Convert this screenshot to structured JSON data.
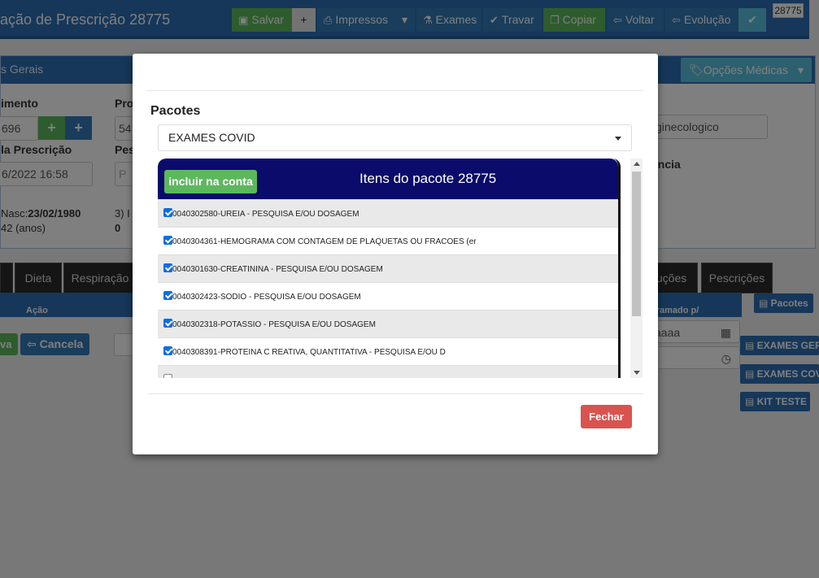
{
  "header": {
    "title": "ação de Prescrição 28775",
    "badge": "28775",
    "buttons": {
      "salvar": "Salvar",
      "plus": "+",
      "impressos": "Impressos",
      "exames": "Exames",
      "travar": "Travar",
      "copiar": "Copiar",
      "voltar": "Voltar",
      "evolucao": "Evolução",
      "check": "✔"
    }
  },
  "panel": {
    "title": "s Gerais",
    "opcoes_medicas": "Opções Médicas",
    "labels": {
      "atendimento": "imento",
      "prof": "Pro",
      "data_prescricao": "la Prescrição",
      "pes": "Pes",
      "urgencia": "ência"
    },
    "values": {
      "atendimento": "696",
      "prof": "54",
      "data_prescricao": "6/2022 16:58",
      "pes": "P",
      "tipo": "ginecologico",
      "nasc_label": "Nasc:",
      "nasc_value": "23/02/1980",
      "idade": "42 (anos)",
      "item3": "3) I",
      "item3_value": "0"
    }
  },
  "tabs": [
    "",
    "Dieta",
    "Respiração",
    "luções",
    "Pescrições"
  ],
  "table": {
    "col_acao": "Ação",
    "col_programado": "gramado p/",
    "date_placeholder": "aaaa"
  },
  "actions": {
    "salva": "va",
    "cancela": "Cancela"
  },
  "side_buttons": {
    "pacotes": "Pacotes",
    "exames_ger": "EXAMES GER",
    "exames_cov": "EXAMES COV",
    "kit_teste": "KIT TESTE"
  },
  "modal": {
    "pacotes_label": "Pacotes",
    "selected_package": "EXAMES COVID",
    "incluir_label": "incluir na conta",
    "items_title": "Itens do pacote 28775",
    "items": [
      {
        "text": "0040302580-UREIA - PESQUISA E/OU DOSAGEM",
        "checked": true
      },
      {
        "text": "0040304361-HEMOGRAMA COM CONTAGEM DE PLAQUETAS OU FRACOES (er",
        "checked": true
      },
      {
        "text": "0040301630-CREATININA - PESQUISA E/OU DOSAGEM",
        "checked": true
      },
      {
        "text": "0040302423-SODIO - PESQUISA E/OU DOSAGEM",
        "checked": true
      },
      {
        "text": "0040302318-POTASSIO - PESQUISA E/OU DOSAGEM",
        "checked": true
      },
      {
        "text": "0040308391-PROTEINA C REATIVA, QUANTITATIVA - PESQUISA E/OU D",
        "checked": true
      },
      {
        "text": "",
        "checked": false
      }
    ],
    "fechar_label": "Fechar"
  },
  "colors": {
    "primary": "#2d6fb3",
    "success": "#5cb85c",
    "danger": "#d9534f",
    "items_header": "#0b0b6b"
  }
}
